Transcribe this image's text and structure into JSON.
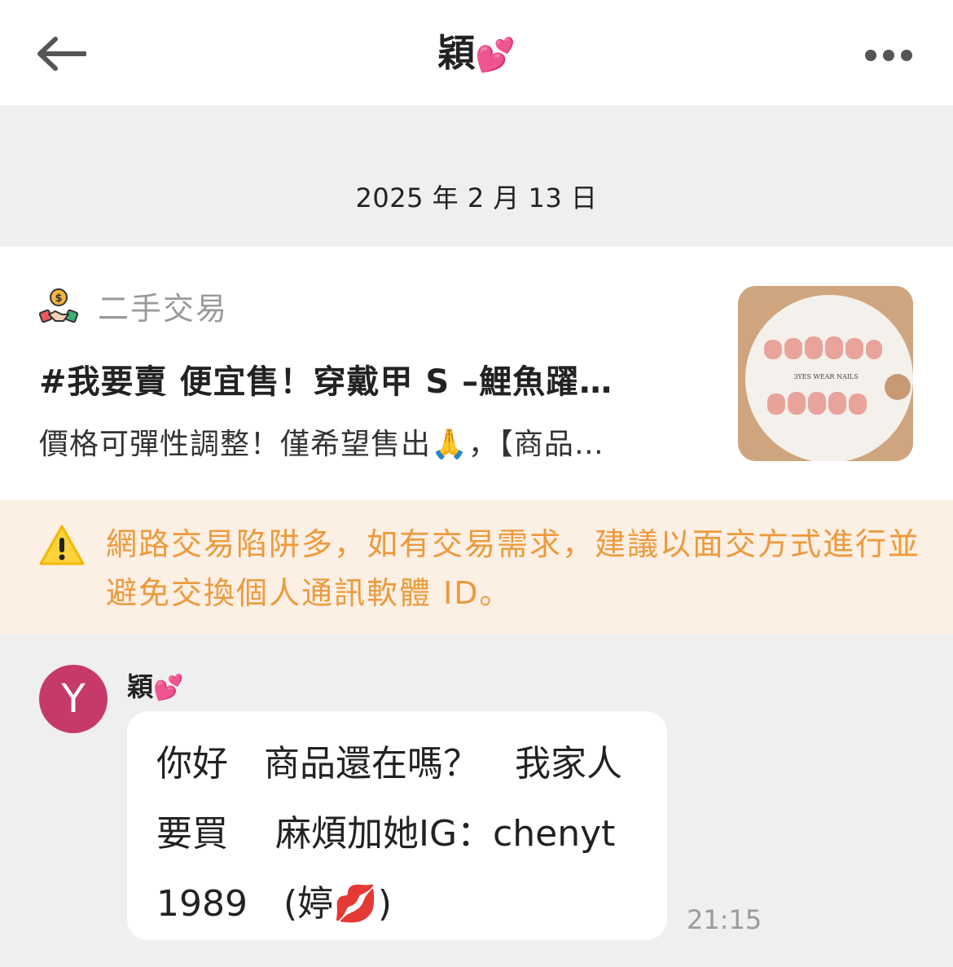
{
  "header": {
    "title": "穎",
    "title_emoji": "💕",
    "back_icon": "arrow-left-icon",
    "more_icon": "more-horizontal-icon"
  },
  "date_separator": "2025 年 2 月 13 日",
  "post": {
    "category_icon": "handshake-money-icon",
    "category": "二手交易",
    "title": "#我要賣 便宜售！穿戴甲 S –鯉魚躍…",
    "excerpt": "價格可彈性調整！僅希望售出🙏，【商品…",
    "thumbnail_text": "3YES WEAR NAILS"
  },
  "warning": {
    "icon": "warning-icon",
    "text": "網路交易陷阱多，如有交易需求，建議以面交方式進行並避免交換個人通訊軟體 ID。"
  },
  "message": {
    "avatar_letter": "Y",
    "sender": "穎",
    "sender_emoji": "💕",
    "text": "你好　商品還在嗎？　我家人要買　 麻煩加她IG：chenyt1989　(婷💋)",
    "time": "21:15"
  },
  "colors": {
    "warning_text": "#ec9a3c",
    "warning_bg": "#fcefe4",
    "avatar_bg": "#c63a68",
    "background": "#efefef"
  }
}
